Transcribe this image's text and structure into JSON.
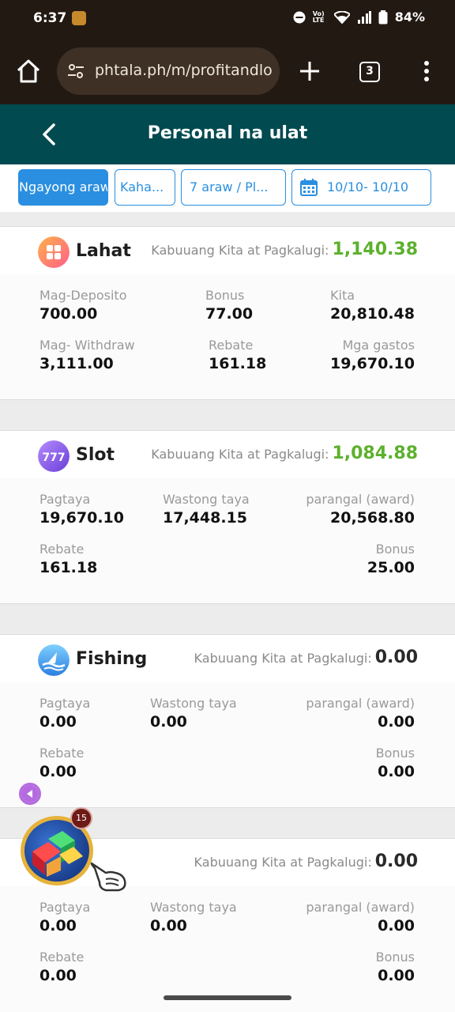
{
  "status": {
    "time": "6:37",
    "battery": "84%",
    "volte": "Vo) LTE"
  },
  "browser": {
    "url": "phtala.ph/m/profitandlo",
    "tab_count": "3"
  },
  "header": {
    "title": "Personal na ulat"
  },
  "filters": {
    "today": "Ngayong araw",
    "kaha": "Kaha...",
    "range": "7 araw / Pl...",
    "date": "10/10- 10/10"
  },
  "cards": [
    {
      "name": "Lahat",
      "total_label": "Kabuuang Kita at Pagkalugi:",
      "total_value": "1,140.38",
      "total_color": "#5cb12d",
      "cells": [
        {
          "label": "Mag-Deposito",
          "value": "700.00"
        },
        {
          "label": "Bonus",
          "value": "77.00"
        },
        {
          "label": "Kita",
          "value": "20,810.48"
        },
        {
          "label": "Mag- Withdraw",
          "value": "3,111.00"
        },
        {
          "label": "Rebate",
          "value": "161.18"
        },
        {
          "label": "Mga gastos",
          "value": "19,670.10"
        }
      ]
    },
    {
      "name": "Slot",
      "total_label": "Kabuuang Kita at Pagkalugi:",
      "total_value": "1,084.88",
      "total_color": "#5cb12d",
      "cells": [
        {
          "label": "Pagtaya",
          "value": "19,670.10"
        },
        {
          "label": "Wastong taya",
          "value": "17,448.15"
        },
        {
          "label": "parangal (award)",
          "value": "20,568.80"
        },
        {
          "label": "Rebate",
          "value": "161.18"
        },
        {
          "label": "Bonus",
          "value": "25.00"
        }
      ]
    },
    {
      "name": "Fishing",
      "total_label": "Kabuuang Kita at Pagkalugi:",
      "total_value": "0.00",
      "total_color": "#2a2a2a",
      "cells": [
        {
          "label": "Pagtaya",
          "value": "0.00"
        },
        {
          "label": "Wastong taya",
          "value": "0.00"
        },
        {
          "label": "parangal (award)",
          "value": "0.00"
        },
        {
          "label": "Rebate",
          "value": "0.00"
        },
        {
          "label": "Bonus",
          "value": "0.00"
        }
      ]
    },
    {
      "name": "",
      "total_label": "Kabuuang Kita at Pagkalugi:",
      "total_value": "0.00",
      "total_color": "#2a2a2a",
      "cells": [
        {
          "label": "Pagtaya",
          "value": "0.00"
        },
        {
          "label": "Wastong taya",
          "value": "0.00"
        },
        {
          "label": "parangal (award)",
          "value": "0.00"
        },
        {
          "label": "Rebate",
          "value": "0.00"
        },
        {
          "label": "Bonus",
          "value": "0.00"
        }
      ]
    }
  ],
  "floating": {
    "badge_count": "15"
  },
  "icons": [
    "home-icon",
    "tune-icon",
    "plus-icon",
    "tabs-icon",
    "more-vert-icon",
    "back-icon",
    "calendar-icon",
    "grid-icon",
    "slot-777-icon",
    "shark-icon",
    "play-left-icon",
    "pointing-hand-icon"
  ],
  "colors": {
    "header_bg": "#004a50",
    "accent_blue": "#2a8fe0",
    "profit_green": "#5cb12d",
    "browser_bg": "#231913"
  }
}
